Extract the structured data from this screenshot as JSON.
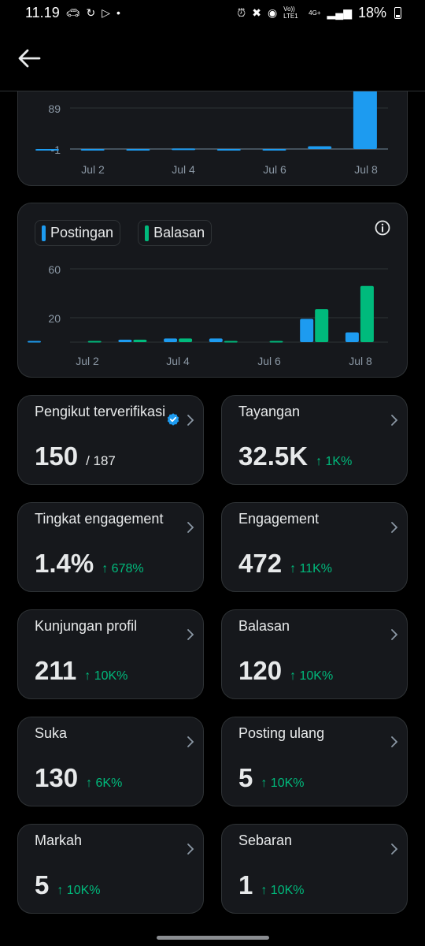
{
  "status_bar": {
    "time": "11.19",
    "left_icons": [
      "car-icon",
      "route-icon",
      "play-store-icon",
      "dot-icon"
    ],
    "right_icons": [
      "alarm-icon",
      "mute-icon",
      "location-icon",
      "signal-icon"
    ],
    "network_volte": "Vo)) LTE1",
    "network_type": "4G+",
    "battery": "18%"
  },
  "header": {
    "back_icon": "arrow-left-icon"
  },
  "chart_top": {
    "chart_data": {
      "type": "bar",
      "y_ticks": [
        "89",
        "-1"
      ],
      "x_ticks": [
        "Jul 2",
        "Jul 4",
        "Jul 6",
        "Jul 8"
      ],
      "series": [
        {
          "color": "#1d9bf0",
          "values": [
            0,
            0,
            0,
            1,
            0,
            0,
            6,
            190
          ]
        }
      ],
      "visible_range": [
        -1,
        89
      ]
    }
  },
  "chart_posts": {
    "legend": [
      {
        "label": "Postingan",
        "color": "#1d9bf0"
      },
      {
        "label": "Balasan",
        "color": "#00ba7c"
      }
    ],
    "info_icon": "info-icon",
    "chart_data": {
      "type": "bar",
      "x": [
        "Jul 1",
        "Jul 2",
        "Jul 3",
        "Jul 4",
        "Jul 5",
        "Jul 6",
        "Jul 7",
        "Jul 8"
      ],
      "x_ticks": [
        "Jul 2",
        "Jul 4",
        "Jul 6",
        "Jul 8"
      ],
      "y_ticks": [
        "60",
        "20"
      ],
      "ylim": [
        0,
        60
      ],
      "series": [
        {
          "name": "Postingan",
          "color": "#1d9bf0",
          "values": [
            1,
            0,
            2,
            3,
            3,
            0,
            19,
            8
          ]
        },
        {
          "name": "Balasan",
          "color": "#00ba7c",
          "values": [
            0,
            1,
            2,
            3,
            1,
            1,
            27,
            46
          ]
        }
      ]
    }
  },
  "metrics": [
    {
      "title": "Pengikut terverifikasi",
      "value": "150",
      "sub": "/ 187",
      "change": "",
      "verified": true
    },
    {
      "title": "Tayangan",
      "value": "32.5K",
      "sub": "",
      "change": "↑ 1K%"
    },
    {
      "title": "Tingkat engagement",
      "value": "1.4%",
      "sub": "",
      "change": "↑ 678%"
    },
    {
      "title": "Engagement",
      "value": "472",
      "sub": "",
      "change": "↑ 11K%"
    },
    {
      "title": "Kunjungan profil",
      "value": "211",
      "sub": "",
      "change": "↑ 10K%"
    },
    {
      "title": "Balasan",
      "value": "120",
      "sub": "",
      "change": "↑ 10K%"
    },
    {
      "title": "Suka",
      "value": "130",
      "sub": "",
      "change": "↑ 6K%"
    },
    {
      "title": "Posting ulang",
      "value": "5",
      "sub": "",
      "change": "↑ 10K%"
    },
    {
      "title": "Markah",
      "value": "5",
      "sub": "",
      "change": "↑ 10K%"
    },
    {
      "title": "Sebaran",
      "value": "1",
      "sub": "",
      "change": "↑ 10K%"
    }
  ]
}
